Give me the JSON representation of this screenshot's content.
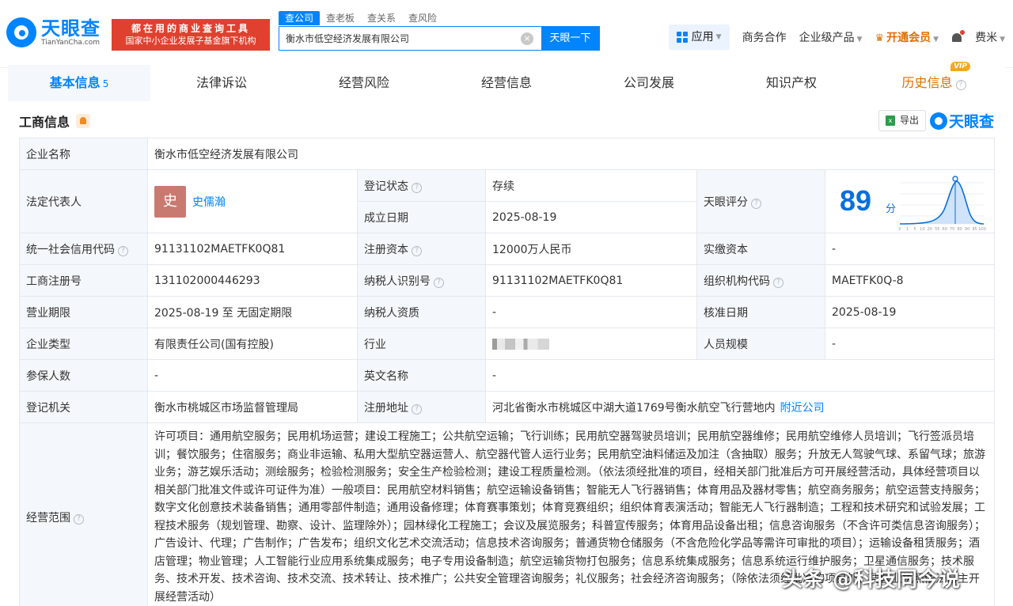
{
  "header": {
    "logo_name": "天眼查",
    "logo_domain": "TianYanCha.com",
    "promo_line1": "都在用的商业查询工具",
    "promo_line2": "国家中小企业发展子基金旗下机构",
    "search_tabs": [
      "查公司",
      "查老板",
      "查关系",
      "查风险"
    ],
    "search_value": "衡水市低空经济发展有限公司",
    "search_button": "天眼一下",
    "nav": {
      "app": "应用",
      "business": "商务合作",
      "enterprise": "企业级产品",
      "vip": "开通会员",
      "user": "费米"
    }
  },
  "tabs": [
    {
      "label": "基本信息",
      "count": "5"
    },
    {
      "label": "法律诉讼"
    },
    {
      "label": "经营风险"
    },
    {
      "label": "经营信息"
    },
    {
      "label": "公司发展"
    },
    {
      "label": "知识产权"
    },
    {
      "label": "历史信息",
      "badge": "VIP"
    }
  ],
  "section": {
    "title": "工商信息",
    "export": "导出",
    "brand": "天眼查"
  },
  "info": {
    "company_name_label": "企业名称",
    "company_name": "衡水市低空经济发展有限公司",
    "legal_rep_label": "法定代表人",
    "legal_rep_avatar": "史",
    "legal_rep": "史儒瀚",
    "reg_status_label": "登记状态",
    "reg_status": "存续",
    "found_date_label": "成立日期",
    "found_date": "2025-08-19",
    "score_label": "天眼评分",
    "score": "89",
    "score_unit": "分",
    "score_ticks": [
      "0",
      "1",
      "5",
      "10",
      "20",
      "55",
      "60",
      "70",
      "80",
      "90",
      "95",
      "100"
    ],
    "credit_code_label": "统一社会信用代码",
    "credit_code": "91131102MAETFK0Q81",
    "reg_capital_label": "注册资本",
    "reg_capital": "12000万人民币",
    "paid_capital_label": "实缴资本",
    "paid_capital": "-",
    "reg_no_label": "工商注册号",
    "reg_no": "131102000446293",
    "tax_id_label": "纳税人识别号",
    "tax_id": "91131102MAETFK0Q81",
    "org_code_label": "组织机构代码",
    "org_code": "MAETFK0Q-8",
    "term_label": "营业期限",
    "term": "2025-08-19 至 无固定期限",
    "taxpayer_label": "纳税人资质",
    "taxpayer": "-",
    "approve_label": "核准日期",
    "approve": "2025-08-19",
    "type_label": "企业类型",
    "type": "有限责任公司(国有控股)",
    "industry_label": "行业",
    "staff_label": "人员规模",
    "staff": "-",
    "insured_label": "参保人数",
    "insured": "-",
    "english_label": "英文名称",
    "english": "-",
    "authority_label": "登记机关",
    "authority": "衡水市桃城区市场监督管理局",
    "address_label": "注册地址",
    "address": "河北省衡水市桃城区中湖大道1769号衡水航空飞行营地内",
    "nearby": "附近公司",
    "scope_label": "经营范围",
    "scope": "许可项目：通用航空服务；民用机场运营；建设工程施工；公共航空运输；飞行训练；民用航空器驾驶员培训；民用航空器维修；民用航空维修人员培训；飞行签派员培训；餐饮服务；住宿服务；商业非运输、私用大型航空器运营人、航空器代管人运行业务；民用航空油料储运及加注（含抽取）服务；升放无人驾驶气球、系留气球；旅游业务；游艺娱乐活动；测绘服务；检验检测服务；安全生产检验检测；建设工程质量检测。（依法须经批准的项目，经相关部门批准后方可开展经营活动，具体经营项目以相关部门批准文件或许可证件为准）一般项目：民用航空材料销售；航空运输设备销售；智能无人飞行器销售；体育用品及器材零售；航空商务服务；航空运营支持服务；数字文化创意技术装备销售；通用零部件制造；通用设备修理；体育赛事策划；体育竞赛组织；组织体育表演活动；智能无人飞行器制造；工程和技术研究和试验发展；工程技术服务（规划管理、勘察、设计、监理除外）；园林绿化工程施工；会议及展览服务；科普宣传服务；体育用品设备出租；信息咨询服务（不含许可类信息咨询服务）；广告设计、代理；广告制作；广告发布；组织文化艺术交流活动；信息技术咨询服务；普通货物仓储服务（不含危险化学品等需许可审批的项目）；运输设备租赁服务；酒店管理；物业管理；人工智能行业应用系统集成服务；电子专用设备制造；航空运输货物打包服务；信息系统集成服务；信息系统运行维护服务；卫星通信服务；技术服务、技术开发、技术咨询、技术交流、技术转让、技术推广；公共安全管理咨询服务；礼仪服务；社会经济咨询服务；（除依法须经批准的项目外，凭营业执照依法自主开展经营活动）"
  },
  "watermark": "头条 @科技同今说",
  "colors": {
    "accent": "#0084ff",
    "promo": "#e0412f",
    "vip": "#e26d00",
    "status": "#22a45d"
  }
}
